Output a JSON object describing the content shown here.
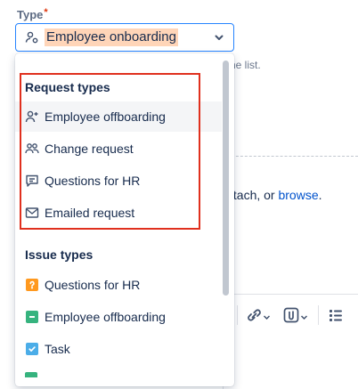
{
  "field": {
    "label": "Type",
    "required_mark": "*",
    "selected_value": "Employee onboarding"
  },
  "background": {
    "hint_fragment": "he list.",
    "attach_fragment": "ttach, or ",
    "browse_link": "browse",
    "period": "."
  },
  "menu": {
    "request_group": "Request types",
    "request_items": [
      {
        "label": "Employee offboarding",
        "icon": "person-add-icon"
      },
      {
        "label": "Change request",
        "icon": "people-icon"
      },
      {
        "label": "Questions for HR",
        "icon": "comment-icon"
      },
      {
        "label": "Emailed request",
        "icon": "email-icon"
      }
    ],
    "issue_group": "Issue types",
    "issue_items": [
      {
        "label": "Questions for HR",
        "icon": "question-square-icon",
        "color": "#ff991f"
      },
      {
        "label": "Employee offboarding",
        "icon": "minus-square-icon",
        "color": "#36b37e"
      },
      {
        "label": "Task",
        "icon": "check-square-icon",
        "color": "#4bade8"
      }
    ]
  },
  "colors": {
    "focus_border": "#2684ff",
    "highlight_box": "#e0301e",
    "selected_text_bg": "#ffd5b8",
    "link": "#0052cc"
  }
}
